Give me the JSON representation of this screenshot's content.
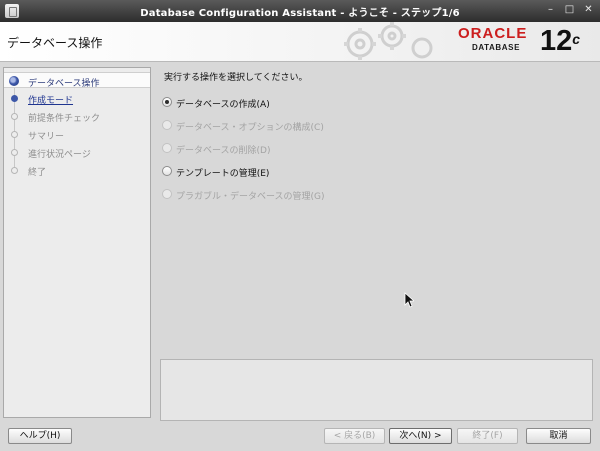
{
  "window": {
    "title": "Database Configuration Assistant - ようこそ - ステップ1/6",
    "controls": {
      "minimize": "–",
      "maximize": "□",
      "close": "✕"
    }
  },
  "header": {
    "page_title": "データベース操作",
    "logo_word": "ORACLE",
    "logo_sub": "DATABASE",
    "version": "12",
    "version_suffix": "c"
  },
  "steps": [
    {
      "label": "データベース操作",
      "state": "active"
    },
    {
      "label": "作成モード",
      "state": "link"
    },
    {
      "label": "前提条件チェック",
      "state": "disabled"
    },
    {
      "label": "サマリー",
      "state": "disabled"
    },
    {
      "label": "進行状況ページ",
      "state": "disabled"
    },
    {
      "label": "終了",
      "state": "disabled"
    }
  ],
  "main": {
    "prompt": "実行する操作を選択してください。",
    "options": [
      {
        "label": "データベースの作成(A)",
        "selected": true,
        "enabled": true
      },
      {
        "label": "データベース・オプションの構成(C)",
        "selected": false,
        "enabled": false
      },
      {
        "label": "データベースの削除(D)",
        "selected": false,
        "enabled": false
      },
      {
        "label": "テンプレートの管理(E)",
        "selected": false,
        "enabled": true
      },
      {
        "label": "プラガブル・データベースの管理(G)",
        "selected": false,
        "enabled": false
      }
    ]
  },
  "buttons": {
    "help": "ヘルプ(H)",
    "back": "< 戻る(B)",
    "next": "次へ(N) >",
    "finish": "終了(F)",
    "cancel": "取消"
  },
  "colors": {
    "accent": "#3d57a8",
    "oracle_red": "#cc1e1e"
  }
}
